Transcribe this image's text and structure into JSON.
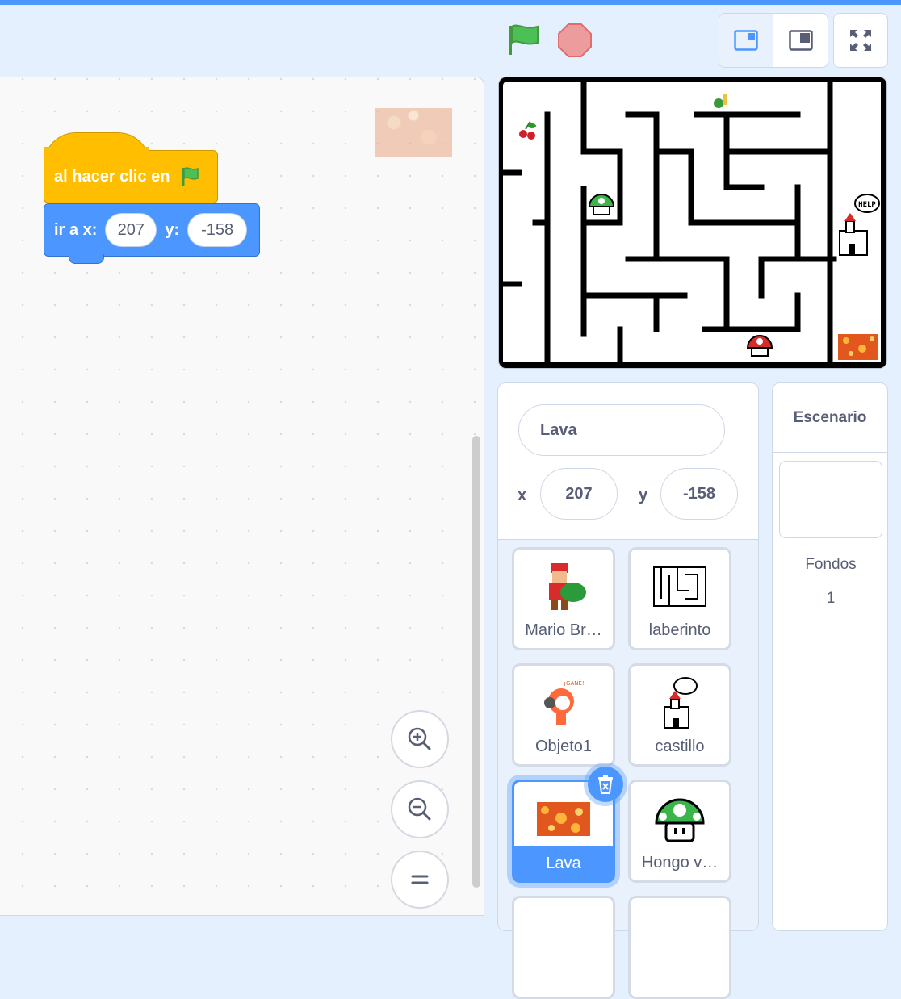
{
  "colors": {
    "accent": "#4c97ff",
    "events_block": "#ffbf00",
    "motion_block": "#4c97ff",
    "text_muted": "#575e75",
    "background": "#e5f0ff"
  },
  "stage_controls": {
    "green_flag_icon": "green-flag-icon",
    "stop_icon": "stop-icon",
    "layout_small_stage_icon": "small-stage-icon",
    "layout_normal_stage_icon": "normal-stage-icon",
    "fullscreen_icon": "fullscreen-icon"
  },
  "script": {
    "hat_label": "al hacer clic en",
    "motion_label_x": "ir a x:",
    "motion_x_value": "207",
    "motion_label_y": "y:",
    "motion_y_value": "-158"
  },
  "zoom": {
    "zoom_in_icon": "zoom-in-icon",
    "zoom_out_icon": "zoom-out-icon",
    "reset_icon": "zoom-reset-icon"
  },
  "sprite_info": {
    "name": "Lava",
    "x_label": "x",
    "x_value": "207",
    "y_label": "y",
    "y_value": "-158"
  },
  "sprites": [
    {
      "label": "Mario Br…"
    },
    {
      "label": "laberinto"
    },
    {
      "label": "Objeto1"
    },
    {
      "label": "castillo"
    },
    {
      "label": "Lava",
      "selected": true
    },
    {
      "label": "Hongo v…"
    }
  ],
  "stage_pane": {
    "title": "Escenario",
    "backdrops_label": "Fondos",
    "backdrops_count": "1"
  },
  "stage_text": {
    "help_bubble": "HELP",
    "gane_text": "¡GANÉ!"
  }
}
